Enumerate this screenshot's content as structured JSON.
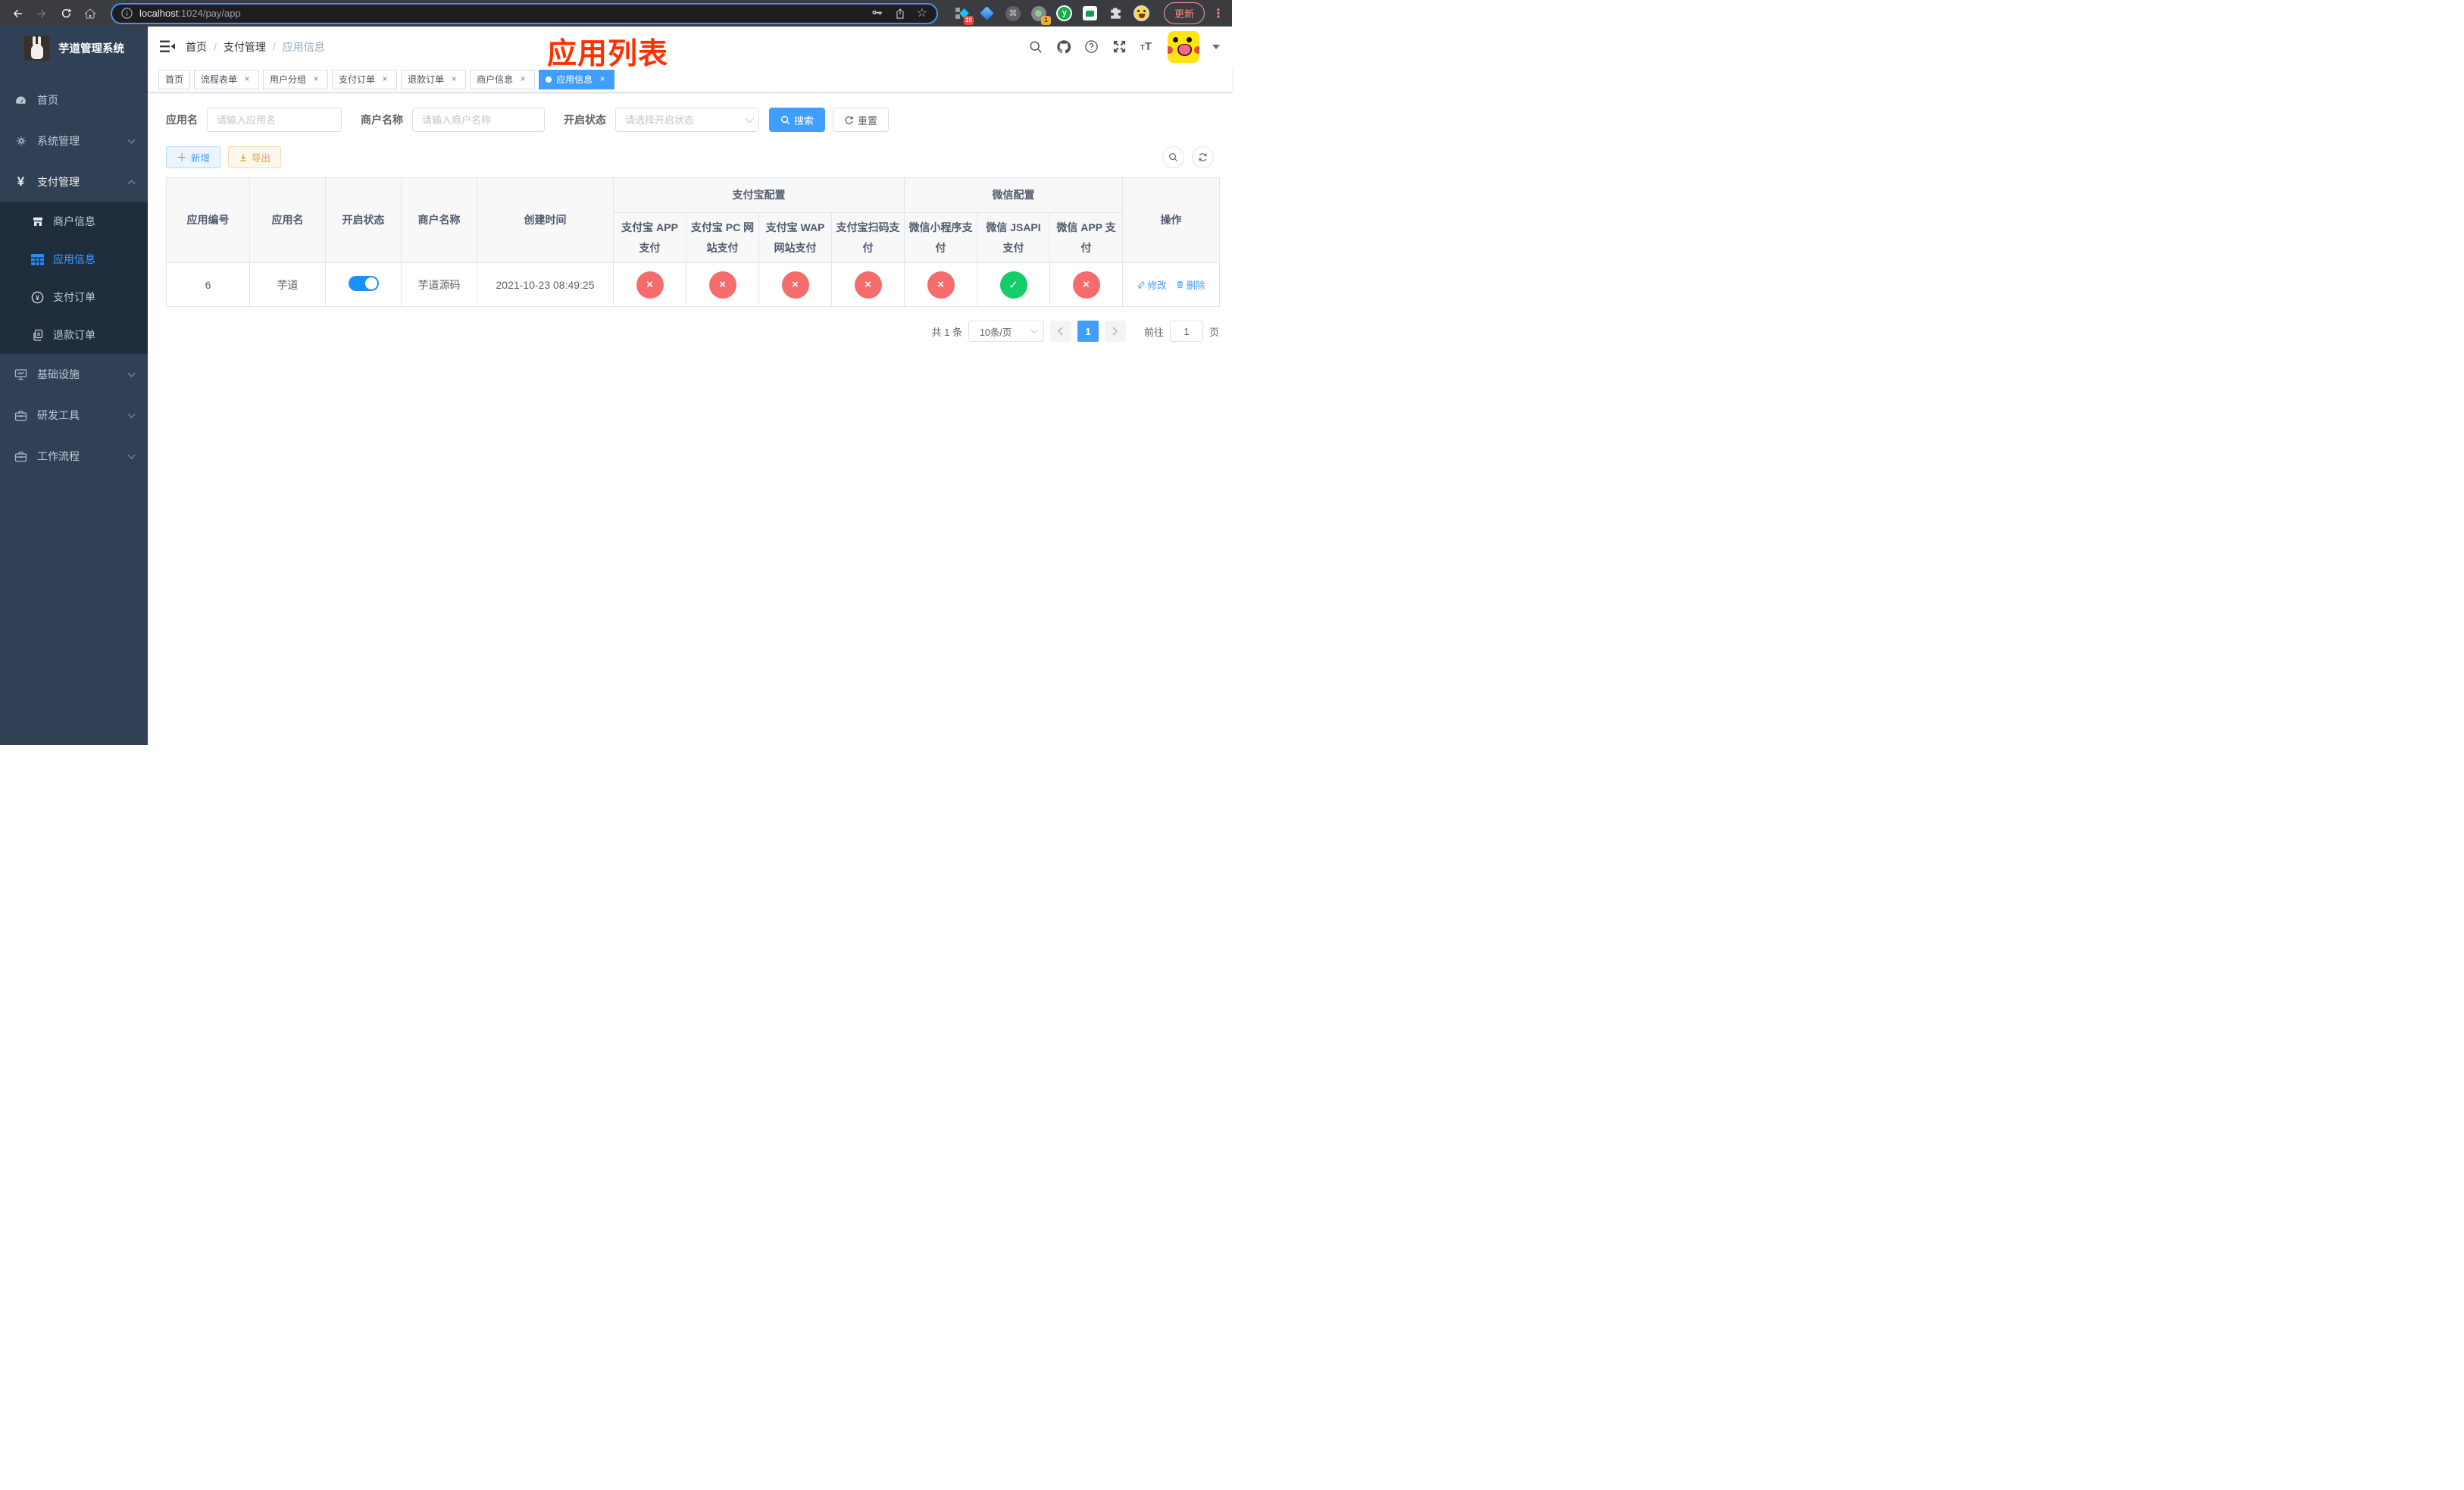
{
  "browser": {
    "url_host": "localhost",
    "url_rest": ":1024/pay/app",
    "update_label": "更新",
    "ext_badge_10": "10",
    "ext_badge_1": "1"
  },
  "sidebar": {
    "title": "芋道管理系统",
    "items": {
      "home": "首页",
      "system": "系统管理",
      "payment": "支付管理",
      "merchant": "商户信息",
      "app_info": "应用信息",
      "pay_order": "支付订单",
      "refund_order": "退款订单",
      "infra": "基础设施",
      "dev_tools": "研发工具",
      "workflow": "工作流程"
    }
  },
  "header": {
    "breadcrumb": {
      "home": "首页",
      "section": "支付管理",
      "current": "应用信息",
      "separator": "/"
    },
    "annotation": "应用列表"
  },
  "tags": [
    {
      "label": "首页",
      "closable": false,
      "active": false
    },
    {
      "label": "流程表单",
      "closable": true,
      "active": false
    },
    {
      "label": "用户分组",
      "closable": true,
      "active": false
    },
    {
      "label": "支付订单",
      "closable": true,
      "active": false
    },
    {
      "label": "退款订单",
      "closable": true,
      "active": false
    },
    {
      "label": "商户信息",
      "closable": true,
      "active": false
    },
    {
      "label": "应用信息",
      "closable": true,
      "active": true
    }
  ],
  "filters": {
    "app_name_label": "应用名",
    "app_name_placeholder": "请输入应用名",
    "merchant_label": "商户名称",
    "merchant_placeholder": "请输入商户名称",
    "status_label": "开启状态",
    "status_placeholder": "请选择开启状态",
    "search_label": "搜索",
    "reset_label": "重置"
  },
  "toolbar": {
    "add_label": "新增",
    "export_label": "导出"
  },
  "table": {
    "headers": {
      "app_id": "应用编号",
      "app_name": "应用名",
      "status": "开启状态",
      "merchant_name": "商户名称",
      "create_time": "创建时间",
      "actions": "操作"
    },
    "groups": [
      {
        "label": "支付宝配置",
        "children": [
          "支付宝 APP 支付",
          "支付宝 PC 网站支付",
          "支付宝 WAP 网站支付",
          "支付宝扫码支付"
        ]
      },
      {
        "label": "微信配置",
        "children": [
          "微信小程序支付",
          "微信 JSAPI 支付",
          "微信 APP 支付"
        ]
      }
    ],
    "row": {
      "app_id": "6",
      "app_name": "芋道",
      "enabled": true,
      "merchant_name": "芋道源码",
      "create_time": "2021-10-23 08:49:25",
      "statuses": [
        "fail",
        "fail",
        "fail",
        "fail",
        "fail",
        "success",
        "fail"
      ],
      "edit_label": "修改",
      "delete_label": "删除"
    }
  },
  "pagination": {
    "total_text": "共 1 条",
    "page_size": "10条/页",
    "current_page": "1",
    "goto_label": "前往",
    "goto_value": "1",
    "page_suffix": "页"
  },
  "colors": {
    "accent": "#409eff",
    "toggle_on": "#1890ff",
    "danger": "#f56c6c",
    "success": "#13ce66",
    "warning": "#e6a23c",
    "annotation": "#ff3000",
    "sidebar_bg": "#304156",
    "submenu_bg": "#1f2d3d"
  }
}
